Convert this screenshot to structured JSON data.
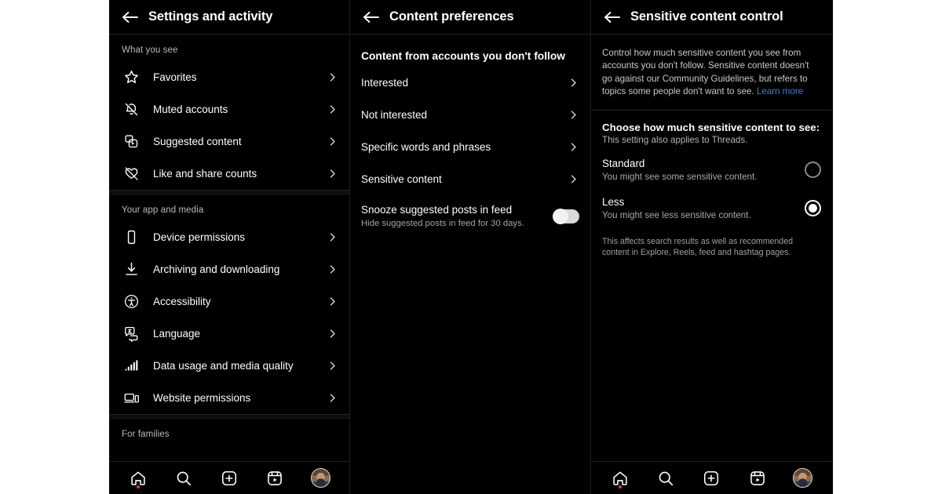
{
  "app": {
    "name": "Instagram",
    "theme": "dark"
  },
  "colors": {
    "background": "#000000",
    "text_primary": "#ffffff",
    "text_secondary": "#b9b9b9",
    "link_blue": "#3e7fd4",
    "badge_red": "#ff2d4b",
    "divider": "#262626"
  },
  "panels": {
    "settings": {
      "header": {
        "title": "Settings and activity",
        "back_icon": "arrow-left-icon"
      },
      "sections": [
        {
          "label": "What you see",
          "items": [
            {
              "label": "Favorites",
              "icon": "star-icon"
            },
            {
              "label": "Muted accounts",
              "icon": "bell-slash-icon"
            },
            {
              "label": "Suggested content",
              "icon": "suggested-content-icon"
            },
            {
              "label": "Like and share counts",
              "icon": "heart-slash-icon"
            }
          ]
        },
        {
          "label": "Your app and media",
          "items": [
            {
              "label": "Device permissions",
              "icon": "phone-icon"
            },
            {
              "label": "Archiving and downloading",
              "icon": "download-icon"
            },
            {
              "label": "Accessibility",
              "icon": "accessibility-icon"
            },
            {
              "label": "Language",
              "icon": "language-icon"
            },
            {
              "label": "Data usage and media quality",
              "icon": "signal-bars-icon"
            },
            {
              "label": "Website permissions",
              "icon": "website-permissions-icon"
            }
          ]
        },
        {
          "label": "For families",
          "items": []
        }
      ]
    },
    "content_preferences": {
      "header": {
        "title": "Content preferences",
        "back_icon": "arrow-left-icon"
      },
      "section_title": "Content from accounts you don't follow",
      "items": [
        {
          "label": "Interested"
        },
        {
          "label": "Not interested"
        },
        {
          "label": "Specific words and phrases"
        },
        {
          "label": "Sensitive content"
        }
      ],
      "toggle": {
        "title": "Snooze suggested posts in feed",
        "subtitle": "Hide suggested posts in feed for 30 days.",
        "state": "off"
      }
    },
    "sensitive_content": {
      "header": {
        "title": "Sensitive content control",
        "back_icon": "arrow-left-icon"
      },
      "description": "Control how much sensitive content you see from accounts you don't follow. Sensitive content doesn't go against our Community Guidelines, but refers to topics some people don't want to see. ",
      "learn_more": "Learn more",
      "choose_title": "Choose how much sensitive content to see:",
      "choose_subtitle": "This setting also applies to Threads.",
      "options": [
        {
          "title": "Standard",
          "subtitle": "You might see some sensitive content.",
          "selected": false
        },
        {
          "title": "Less",
          "subtitle": "You might see less sensitive content.",
          "selected": true
        }
      ],
      "footnote": "This affects search results as well as recommended content in Explore, Reels, feed and hashtag pages."
    }
  },
  "bottom_nav": {
    "items": [
      {
        "icon": "home-icon",
        "badge": true
      },
      {
        "icon": "search-icon",
        "badge": false
      },
      {
        "icon": "create-post-icon",
        "badge": false
      },
      {
        "icon": "reels-icon",
        "badge": false
      },
      {
        "icon": "profile-avatar",
        "badge": false
      }
    ]
  }
}
